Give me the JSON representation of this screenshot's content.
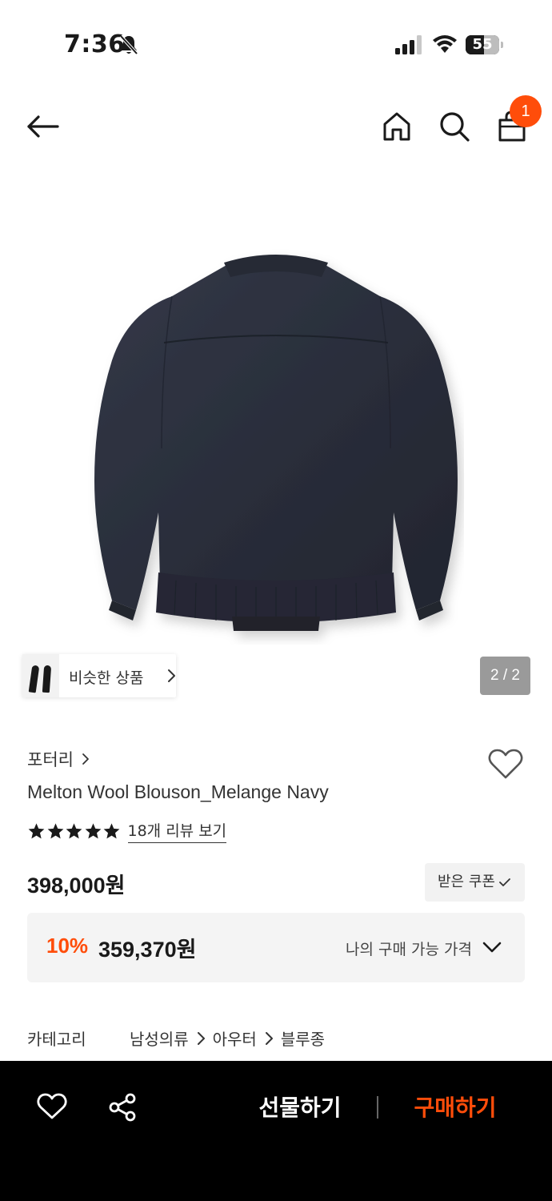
{
  "status_bar": {
    "time": "7:36",
    "battery_level": "55",
    "battery_fraction": 0.55
  },
  "nav": {
    "cart_count": "1"
  },
  "gallery": {
    "similar_label": "비슷한 상품",
    "page_indicator": "2 / 2"
  },
  "product": {
    "brand": "포터리",
    "title": "Melton Wool Blouson_Melange Navy",
    "rating": 5,
    "review_link": "18개 리뷰 보기",
    "price": "398,000원",
    "coupon_label": "받은 쿠폰"
  },
  "my_price": {
    "discount": "10%",
    "price": "359,370원",
    "label": "나의 구매 가능 가격"
  },
  "category": {
    "label": "카테고리",
    "path": [
      "남성의류",
      "아우터",
      "블루종"
    ]
  },
  "bottom_bar": {
    "gift_label": "선물하기",
    "buy_label": "구매하기"
  },
  "colors": {
    "accent": "#ff4d0a",
    "bottom_bar_bg": "#000000",
    "jacket": "#2b2f3d"
  },
  "icons": [
    "back-arrow-icon",
    "home-icon",
    "search-icon",
    "shopping-bag-icon",
    "heart-icon",
    "share-icon",
    "star-icon",
    "chevron-right-icon",
    "chevron-down-icon",
    "check-icon",
    "bell-slash-icon",
    "signal-icon",
    "wifi-icon"
  ]
}
